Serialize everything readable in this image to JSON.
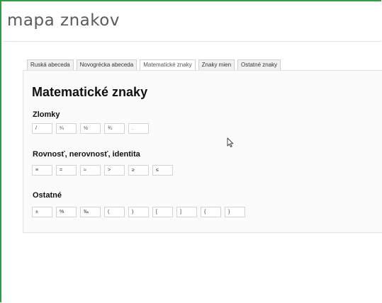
{
  "app": {
    "title": "mapa znakov"
  },
  "tabs": [
    {
      "label": "Ruská abeceda",
      "active": false
    },
    {
      "label": "Novogrécka abeceda",
      "active": false
    },
    {
      "label": "Matematické znaky",
      "active": true
    },
    {
      "label": "Znaky mien",
      "active": false
    },
    {
      "label": "Ostatné znaky",
      "active": false
    }
  ],
  "content": {
    "heading": "Matematické znaky",
    "sections": [
      {
        "title": "Zlomky",
        "symbols": [
          "/",
          "¼",
          "½",
          "¾",
          "."
        ]
      },
      {
        "title": "Rovnosť, nerovnosť, identita",
        "symbols": [
          "≡",
          "=",
          "≈",
          ">",
          "≥",
          "≤"
        ]
      },
      {
        "title": "Ostatné",
        "symbols": [
          "±",
          "%",
          "‰",
          "(",
          ")",
          "[",
          "]",
          "{",
          "}"
        ]
      }
    ]
  },
  "icons": {
    "cursor": "mouse-pointer-icon"
  },
  "colors": {
    "window_border": "#2e9e3e",
    "title_text": "#5a5a5a"
  }
}
